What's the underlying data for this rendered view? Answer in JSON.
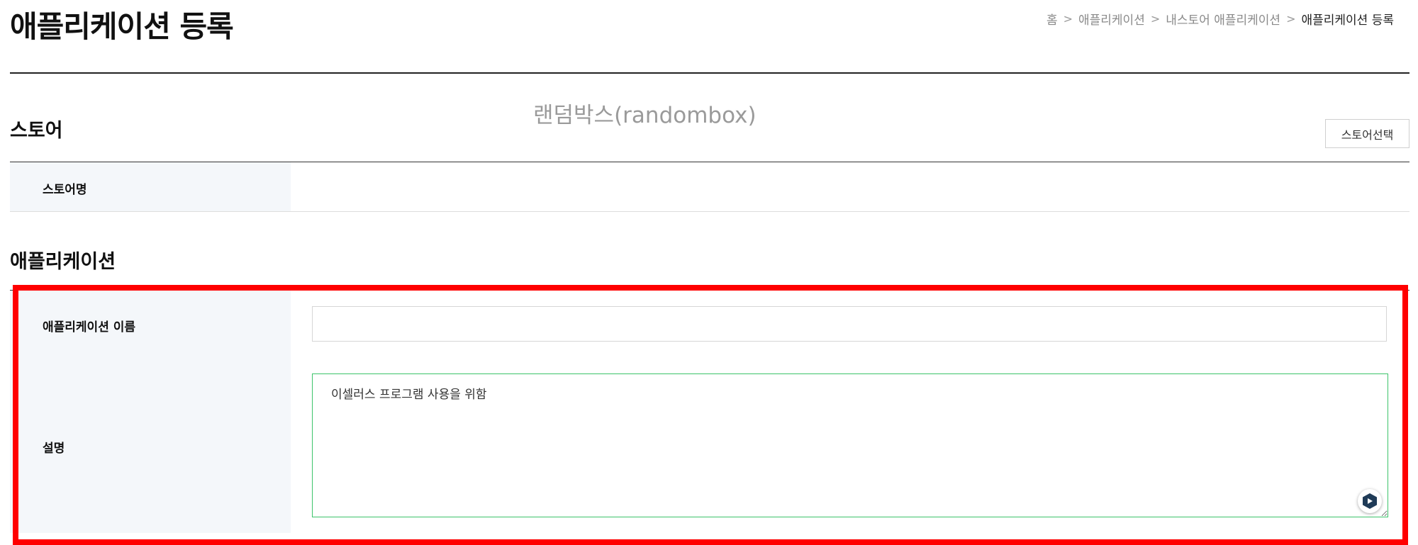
{
  "page": {
    "title": "애플리케이션 등록"
  },
  "breadcrumb": {
    "items": [
      "홈",
      "애플리케이션",
      "내스토어 애플리케이션"
    ],
    "current": "애플리케이션 등록",
    "separator": ">"
  },
  "store_section": {
    "title": "스토어",
    "selected_store_display": "랜덤박스(randombox)",
    "select_button_label": "스토어선택",
    "store_name_label": "스토어명",
    "store_name_value": ""
  },
  "app_section": {
    "title": "애플리케이션",
    "name_label": "애플리케이션 이름",
    "name_value": "",
    "description_label": "설명",
    "description_value": "이셀러스 프로그램 사용을 위함"
  },
  "icons": {
    "assistant": "assistant-icon"
  },
  "colors": {
    "highlight": "#ff0000",
    "focus_border": "#3cc36a",
    "label_background": "#f4f7fa",
    "assistant_icon": "#1f3b57"
  }
}
